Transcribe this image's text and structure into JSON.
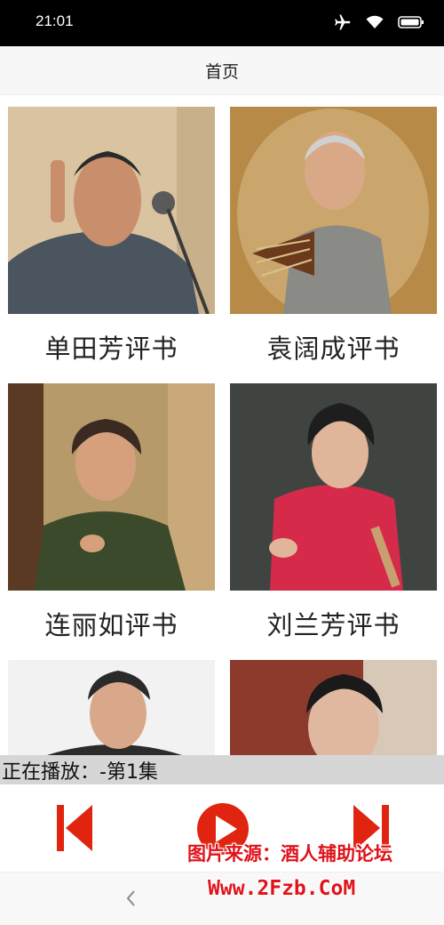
{
  "status_bar": {
    "time": "21:01",
    "icons": [
      "airplane-icon",
      "wifi-icon",
      "battery-icon"
    ]
  },
  "header": {
    "title": "首页"
  },
  "cards": [
    {
      "label": "单田芳评书",
      "bg": "#d9c3a0",
      "suit": "#4a5560"
    },
    {
      "label": "袁阔成评书",
      "bg": "#b78a48",
      "suit": "#8a8a86"
    },
    {
      "label": "连丽如评书",
      "bg": "#b79a6a",
      "suit": "#3c4a2c"
    },
    {
      "label": "刘兰芳评书",
      "bg": "#3f4441",
      "suit": "#d62a4a"
    },
    {
      "label": "",
      "bg": "#f2f2f2",
      "suit": "#2b2b2b"
    },
    {
      "label": "",
      "bg": "#8c3a2c",
      "suit": "#2a2a2a"
    }
  ],
  "now_playing": {
    "text": "正在播放：-第1集"
  },
  "player": {
    "prev_icon": "skip-previous-icon",
    "play_icon": "play-icon",
    "next_icon": "skip-next-icon",
    "accent": "#e02410"
  },
  "watermark": {
    "line1": "图片来源：酒人辅助论坛",
    "line2": "Www.2Fzb.CoM"
  }
}
